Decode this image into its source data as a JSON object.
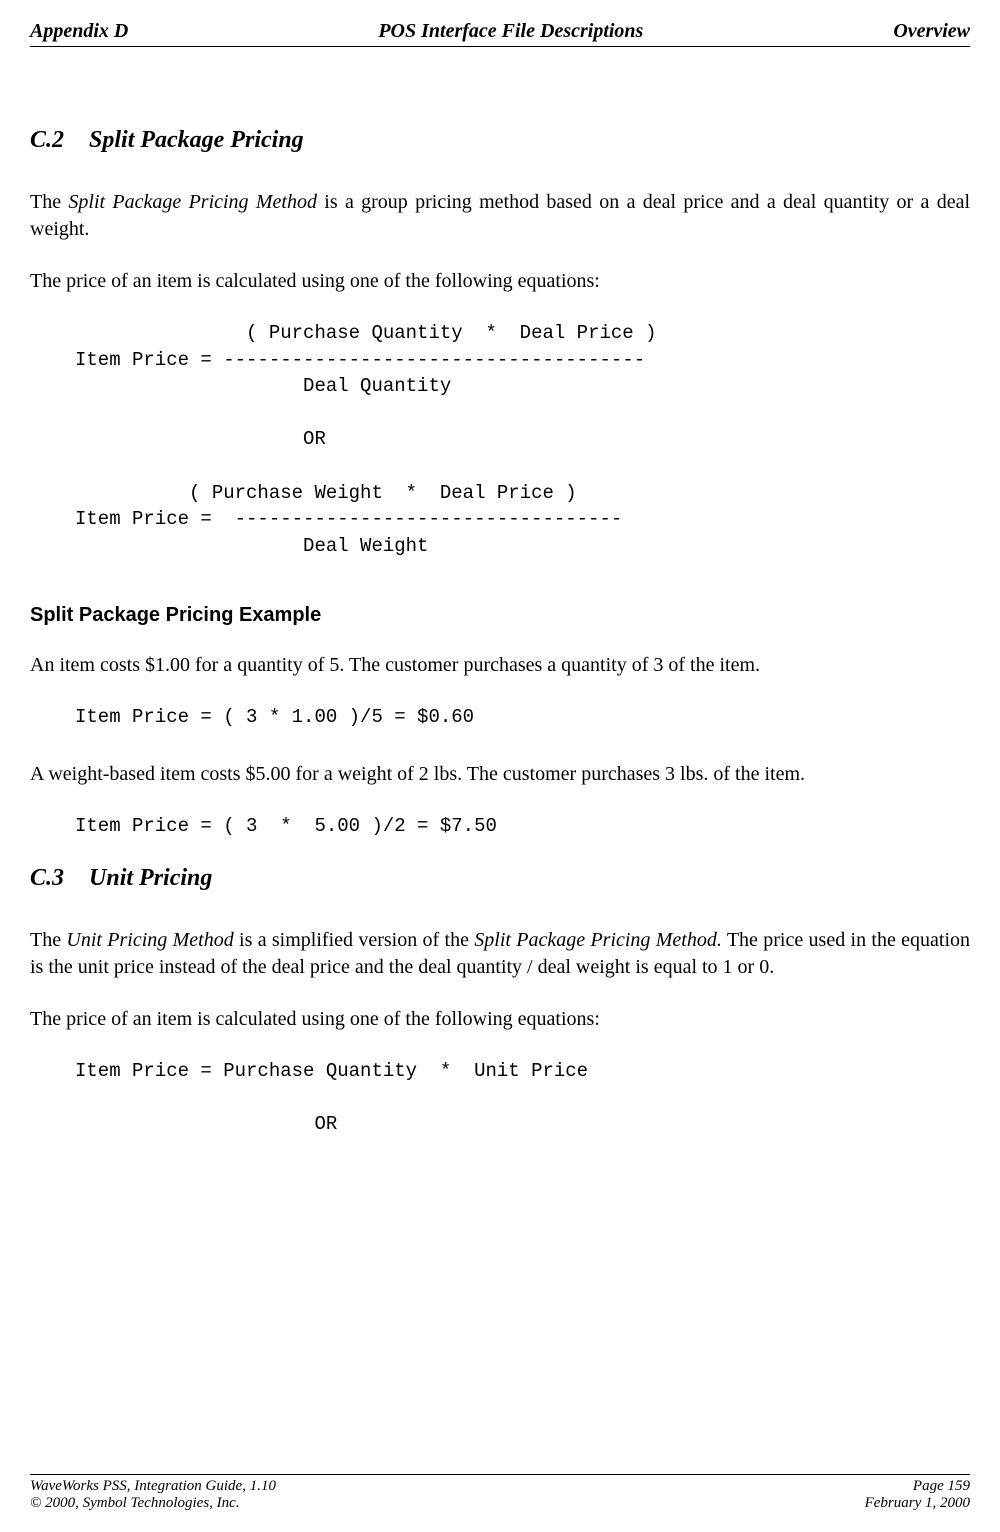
{
  "header": {
    "left": "Appendix D",
    "center": "POS Interface File Descriptions",
    "right": "Overview"
  },
  "section_c2": {
    "number": "C.2",
    "title": "Split Package Pricing",
    "para1_a": "The ",
    "para1_italic": "Split Package Pricing Method",
    "para1_b": " is a group pricing method based on a deal price and a deal quantity or a deal weight.",
    "para2": "The price of an item is calculated using one of the following equations:",
    "equation": "               ( Purchase Quantity  *  Deal Price )\nItem Price = -------------------------------------\n                    Deal Quantity\n\n                    OR\n\n          ( Purchase Weight  *  Deal Price )\nItem Price =  ----------------------------------\n                    Deal Weight"
  },
  "example": {
    "heading": "Split Package Pricing Example",
    "para1": "An item costs $1.00 for a quantity of 5.  The customer purchases a quantity of 3 of the item.",
    "equation1": "Item Price = ( 3 * 1.00 )/5 = $0.60",
    "para2": "A weight-based item costs $5.00 for a weight of 2 lbs.  The customer purchases 3 lbs. of the item.",
    "equation2": "Item Price = ( 3  *  5.00 )/2 = $7.50"
  },
  "section_c3": {
    "number": "C.3",
    "title": "Unit Pricing",
    "para1_a": "The ",
    "para1_italic1": "Unit Pricing Method",
    "para1_b": " is a simplified version of the ",
    "para1_italic2": "Split Package Pricing Method.",
    "para1_c": "  The price used in the equation is the unit price instead of the deal price and the deal quantity / deal weight is equal to 1 or 0.",
    "para2": "The price of an item is calculated using one of the following equations:",
    "equation": "Item Price = Purchase Quantity  *  Unit Price\n\n                     OR"
  },
  "footer": {
    "left_line1": "WaveWorks PSS, Integration Guide, 1.10",
    "left_line2": "© 2000, Symbol Technologies, Inc.",
    "right_line1": "Page 159",
    "right_line2": "February 1, 2000"
  }
}
